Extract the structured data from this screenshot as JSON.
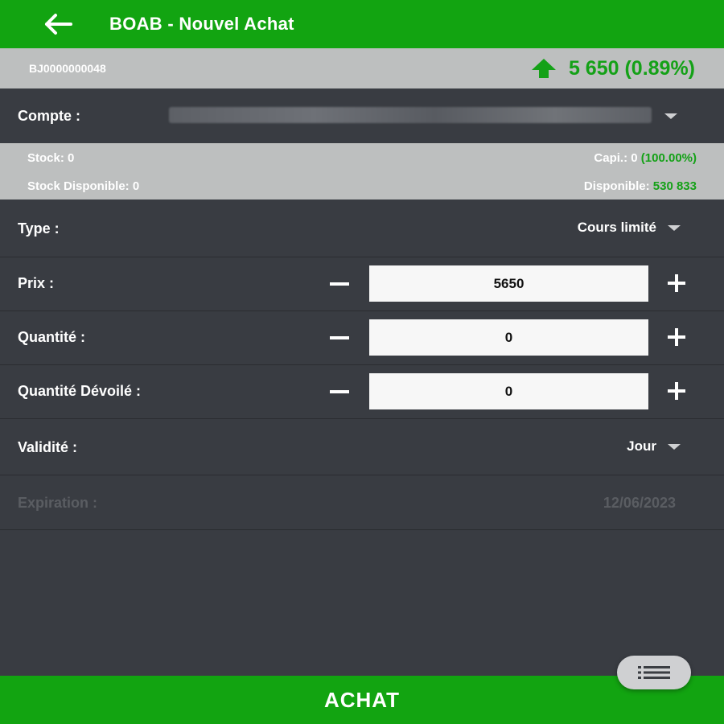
{
  "header": {
    "title": "BOAB - Nouvel Achat",
    "back_icon": "arrow-left-icon"
  },
  "instrument": {
    "isin": "BJ0000000048",
    "trend_icon": "arrow-up-icon",
    "price_change": "5 650 (0.89%)"
  },
  "account": {
    "label": "Compte :",
    "value": ""
  },
  "stock": {
    "stock_label": "Stock:",
    "stock_value": "0",
    "available_stock_label": "Stock Disponible:",
    "available_stock_value": "0",
    "capi_label": "Capi.:",
    "capi_value": "0",
    "capi_percent": "(100.00%)",
    "disponible_label": "Disponible:",
    "disponible_value": "530 833"
  },
  "form": {
    "type_label": "Type :",
    "type_value": "Cours limité",
    "prix_label": "Prix :",
    "prix_value": "5650",
    "quantite_label": "Quantité :",
    "quantite_value": "0",
    "devoile_label": "Quantité Dévoilé :",
    "devoile_value": "0",
    "validite_label": "Validité :",
    "validite_value": "Jour",
    "expiration_label": "Expiration :",
    "expiration_value": "12/06/2023"
  },
  "fab": {
    "icon": "list-icon"
  },
  "footer": {
    "achat_label": "ACHAT"
  },
  "colors": {
    "brand_green": "#12a411",
    "positive_green": "#14a117",
    "background": "#393c42",
    "info_band": "#bdbfbf"
  }
}
